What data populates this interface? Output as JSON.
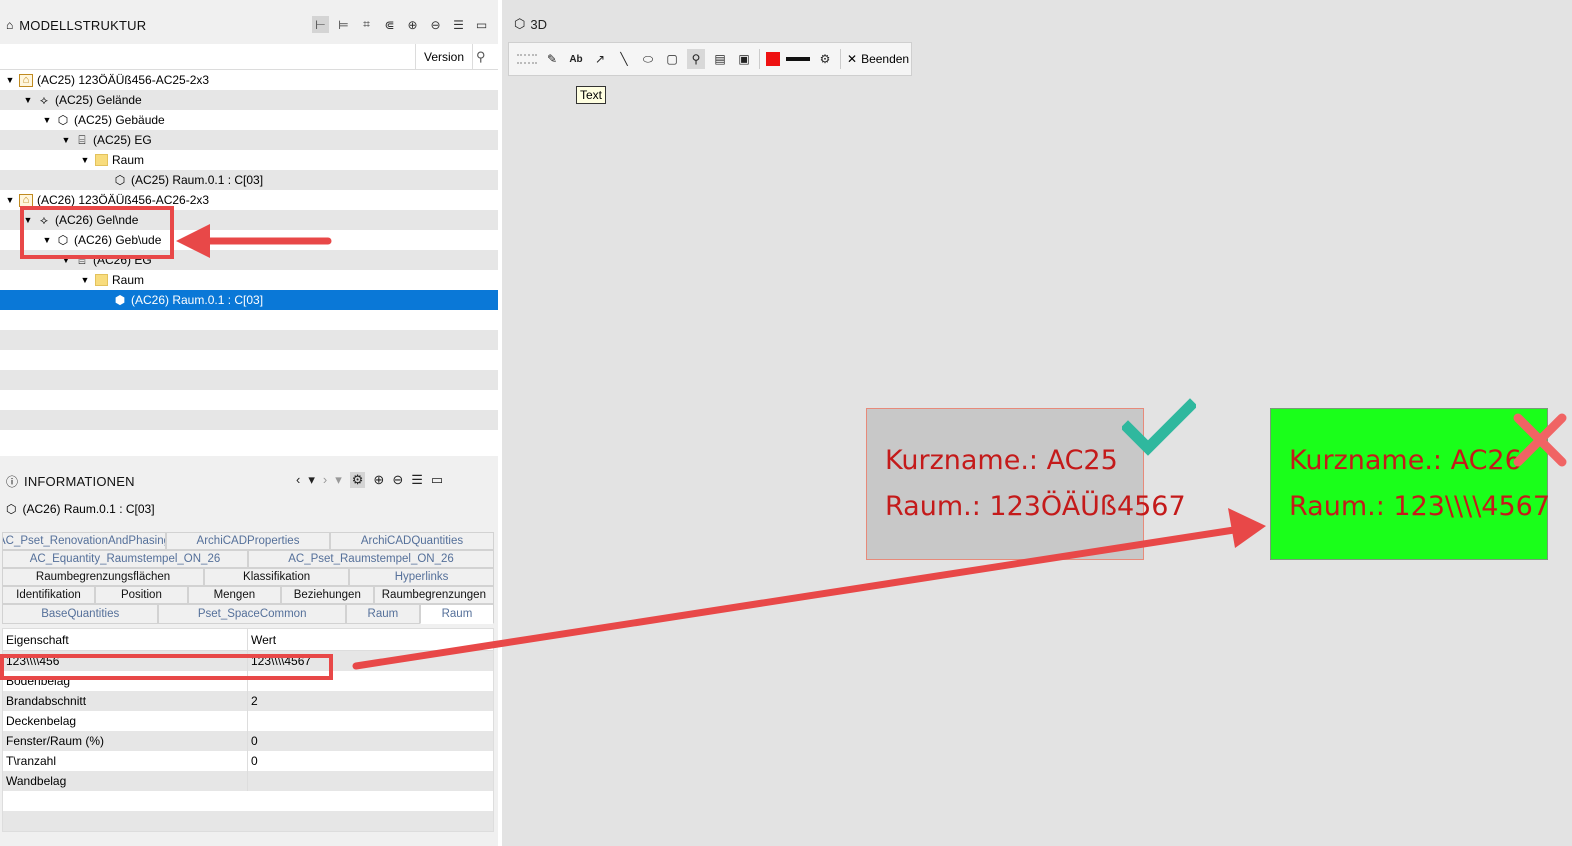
{
  "tree_panel": {
    "title": "MODELLSTRUKTUR",
    "version_col": "Version",
    "rows": [
      {
        "label": "(AC25) 123ÖÄÜß456-AC25-2x3"
      },
      {
        "label": "(AC25) Gelände"
      },
      {
        "label": "(AC25) Gebäude"
      },
      {
        "label": "(AC25) EG"
      },
      {
        "label": "Raum"
      },
      {
        "label": "(AC25) Raum.0.1 : C[03]"
      },
      {
        "label": "(AC26) 123ÖÄÜß456-AC26-2x3"
      },
      {
        "label": "(AC26) Gel\\nde"
      },
      {
        "label": "(AC26) Geb\\ude"
      },
      {
        "label": "(AC26) EG"
      },
      {
        "label": "Raum"
      },
      {
        "label": "(AC26) Raum.0.1 : C[03]"
      }
    ]
  },
  "info_panel": {
    "title": "INFORMATIONEN",
    "selected": "(AC26) Raum.0.1 : C[03]",
    "tabs": {
      "r1": [
        "AC_Pset_RenovationAndPhasing",
        "ArchiCADProperties",
        "ArchiCADQuantities"
      ],
      "r2": [
        "AC_Equantity_Raumstempel_ON_26",
        "AC_Pset_Raumstempel_ON_26"
      ],
      "r3": [
        "Raumbegrenzungsflächen",
        "Klassifikation",
        "Hyperlinks"
      ],
      "r4": [
        "Identifikation",
        "Position",
        "Mengen",
        "Beziehungen",
        "Raumbegrenzungen"
      ],
      "r5": [
        "BaseQuantities",
        "Pset_SpaceCommon",
        "Raum",
        "Raum"
      ]
    },
    "table": {
      "col1": "Eigenschaft",
      "col2": "Wert",
      "rows": [
        {
          "name": "123\\\\\\\\456",
          "value": "123\\\\\\\\4567"
        },
        {
          "name": "Bodenbelag",
          "value": ""
        },
        {
          "name": "Brandabschnitt",
          "value": "2"
        },
        {
          "name": "Deckenbelag",
          "value": ""
        },
        {
          "name": "Fenster/Raum (%)",
          "value": "0"
        },
        {
          "name": "T\\ranzahl",
          "value": "0"
        },
        {
          "name": "Wandbelag",
          "value": ""
        }
      ]
    }
  },
  "view3d": {
    "title": "3D",
    "tooltip": "Text",
    "toolbar_text_btn": "Ab",
    "end_label": "Beenden",
    "colors": {
      "stroke": "#ee1111"
    }
  },
  "labels": {
    "grey": {
      "line1": "Kurzname.: AC25",
      "line2": "Raum.: 123ÖÄÜß4567"
    },
    "green": {
      "line1": "Kurzname.: AC26",
      "line2": "Raum.: 123\\\\\\\\4567"
    }
  },
  "colors": {
    "ok": "#2fb89e",
    "fail": "#f06464",
    "label_text": "#c41a1a",
    "green_bg": "#1aff1a",
    "selection": "#0a78d7"
  }
}
